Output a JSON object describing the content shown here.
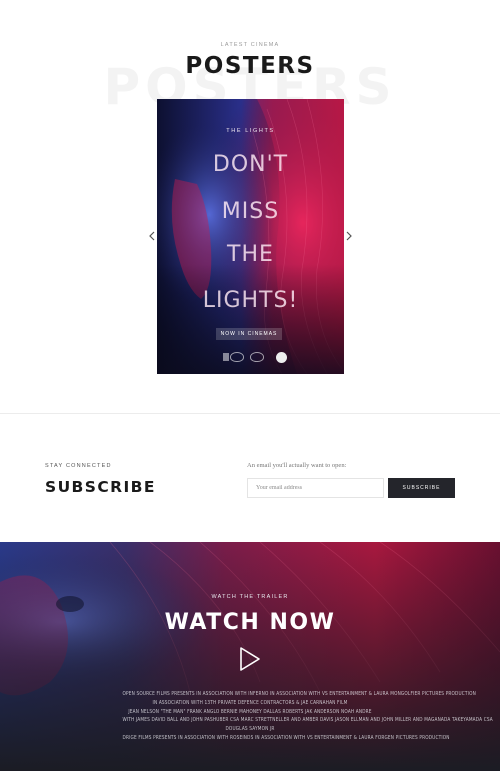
{
  "posters": {
    "eyebrow": "LATEST CINEMA",
    "ghost_text": "POSTERS",
    "title": "POSTERS",
    "prev_icon": "chevron-left-icon",
    "next_icon": "chevron-right-icon",
    "poster": {
      "kicker": "THE LIGHTS",
      "lines": [
        "DON'T",
        "MISS",
        "THE",
        "LIGHTS!"
      ],
      "badge": "NOW IN CINEMAS"
    }
  },
  "subscribe": {
    "eyebrow": "STAY CONNECTED",
    "title": "SUBSCRIBE",
    "note": "An email you'll actually want to open:",
    "placeholder": "Your email address",
    "button": "SUBSCRIBE"
  },
  "trailer": {
    "eyebrow": "WATCH THE TRAILER",
    "title": "WATCH NOW",
    "play_icon": "play-icon",
    "credits": [
      "OPEN SOURCE FILMS PRESENTS IN ASSOCIATION WITH INFERNO IN ASSOCIATION WITH VS ENTERTAINMENT & LAURA MONGOLFIER PICTURES PRODUCTION",
      "IN ASSOCIATION WITH 13TH PRIVATE DEFENCE CONTRACTORS & JAE CARNAHAN FILM",
      "JEAN NELSON \"THE MAN\" FRANK ANGLO BERNIE MAHONEY DALLAS ROBERTS JAK ANDERSON NOAH ANDRE",
      "WITH JAMES DAVID BALL AND JOHN PASHUBER CSA MARC STRETTNELLER AND AMBER DAVIS JASON ELLMAN AND JOHN MILLER AND MAGANADA TAKEYAMADA CSA",
      "DOUGLAS SAYMON JR",
      "DRIGE FILMS PRESENTS IN ASSOCIATION WITH ROSEINDS IN ASSOCIATION WITH VS ENTERTAINMENT & LAURA FORGEN PICTURES PRODUCTION"
    ]
  },
  "colors": {
    "accent_pink": "#e2265a",
    "accent_blue": "#3a4bd6",
    "button_dark": "#24252b"
  }
}
